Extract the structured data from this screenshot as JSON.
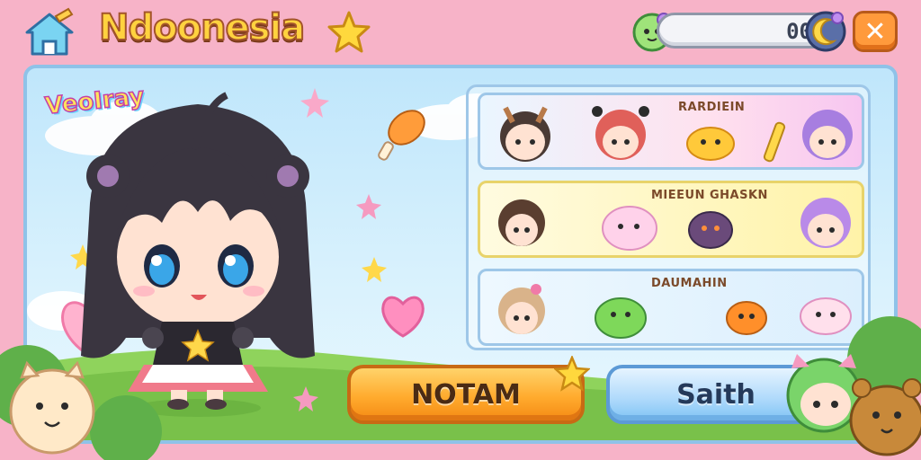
{
  "header": {
    "title": "Ndoonesia",
    "coins": "00",
    "close_label": "✕"
  },
  "panel": {
    "logo": "VeoIray",
    "cards": [
      {
        "label": "RARDIEIN"
      },
      {
        "label": "MIEEUN GHASKN"
      },
      {
        "label": "DAUMAHIN"
      }
    ],
    "buttons": {
      "primary": "NOTAM",
      "secondary": "Saith"
    }
  },
  "colors": {
    "background": "#f7b3c8",
    "sky": "#bfe6fb",
    "grass": "#8fd35c",
    "primary_button": "#ffab2e",
    "secondary_button": "#aed9fb",
    "close_button": "#ff9a3c",
    "title": "#ffd23f"
  },
  "icons": [
    "home-icon",
    "star-icon",
    "gem-icon",
    "close-icon",
    "heart-icon",
    "chicken-leg-icon",
    "sparkle-icon"
  ]
}
